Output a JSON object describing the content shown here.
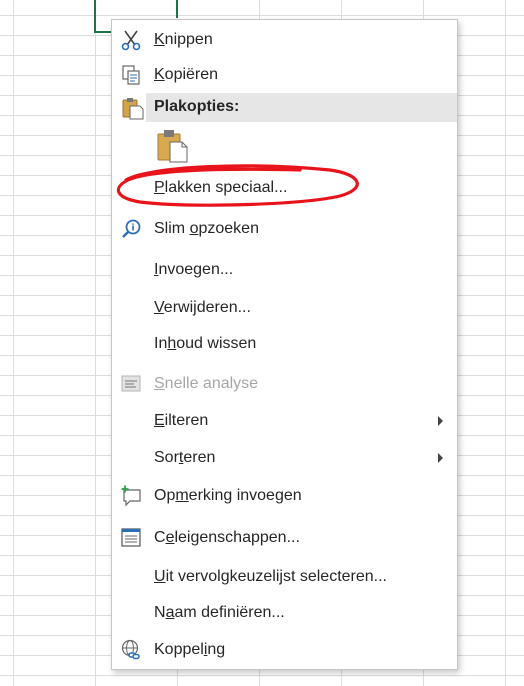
{
  "menu": {
    "items": [
      {
        "id": "knippen",
        "pre": "",
        "key": "K",
        "post": "nippen",
        "icon": "scissors-icon"
      },
      {
        "id": "kopieren",
        "pre": "",
        "key": "K",
        "post": "opiëren",
        "icon": "copy-icon"
      },
      {
        "id": "plakken-speciaal",
        "pre": "",
        "key": "P",
        "post": "lakken speciaal...",
        "icon": ""
      },
      {
        "id": "slim-opzoeken",
        "pre": "Slim ",
        "key": "o",
        "post": "pzoeken",
        "icon": "smart-lookup-icon"
      },
      {
        "id": "invoegen",
        "pre": "",
        "key": "I",
        "post": "nvoegen...",
        "icon": ""
      },
      {
        "id": "verwijderen",
        "pre": "",
        "key": "V",
        "post": "erwijderen...",
        "icon": ""
      },
      {
        "id": "inhoud-wissen",
        "pre": "In",
        "key": "h",
        "post": "oud wissen",
        "icon": ""
      },
      {
        "id": "snelle-analyse",
        "pre": "",
        "key": "S",
        "post": "nelle analyse",
        "icon": "quick-analysis-icon",
        "disabled": true
      },
      {
        "id": "filteren",
        "pre": "",
        "key": "E",
        "post": "ilteren",
        "icon": "",
        "submenu": true
      },
      {
        "id": "sorteren",
        "pre": "Sor",
        "key": "t",
        "post": "eren",
        "icon": "",
        "submenu": true
      },
      {
        "id": "opmerking-invoegen",
        "pre": "Op",
        "key": "m",
        "post": "erking invoegen",
        "icon": "new-comment-icon"
      },
      {
        "id": "celeigenschappen",
        "pre": "C",
        "key": "e",
        "post": "leigenschappen...",
        "icon": "format-cells-icon"
      },
      {
        "id": "vervolgkeuzelijst",
        "pre": "",
        "key": "U",
        "post": "it vervolgkeuzelijst selecteren...",
        "icon": ""
      },
      {
        "id": "naam-definieren",
        "pre": "N",
        "key": "a",
        "post": "am definiëren...",
        "icon": ""
      },
      {
        "id": "koppeling",
        "pre": "Koppel",
        "key": "i",
        "post": "ng",
        "icon": "link-icon"
      }
    ],
    "paste_header": {
      "label": "Plakopties:",
      "icon": "paste-icon"
    },
    "paste_option": {
      "icon": "paste-option-icon"
    }
  },
  "annotation": {
    "color": "#e8131b"
  },
  "colors": {
    "selection": "#217346",
    "grid": "#dadcde"
  }
}
